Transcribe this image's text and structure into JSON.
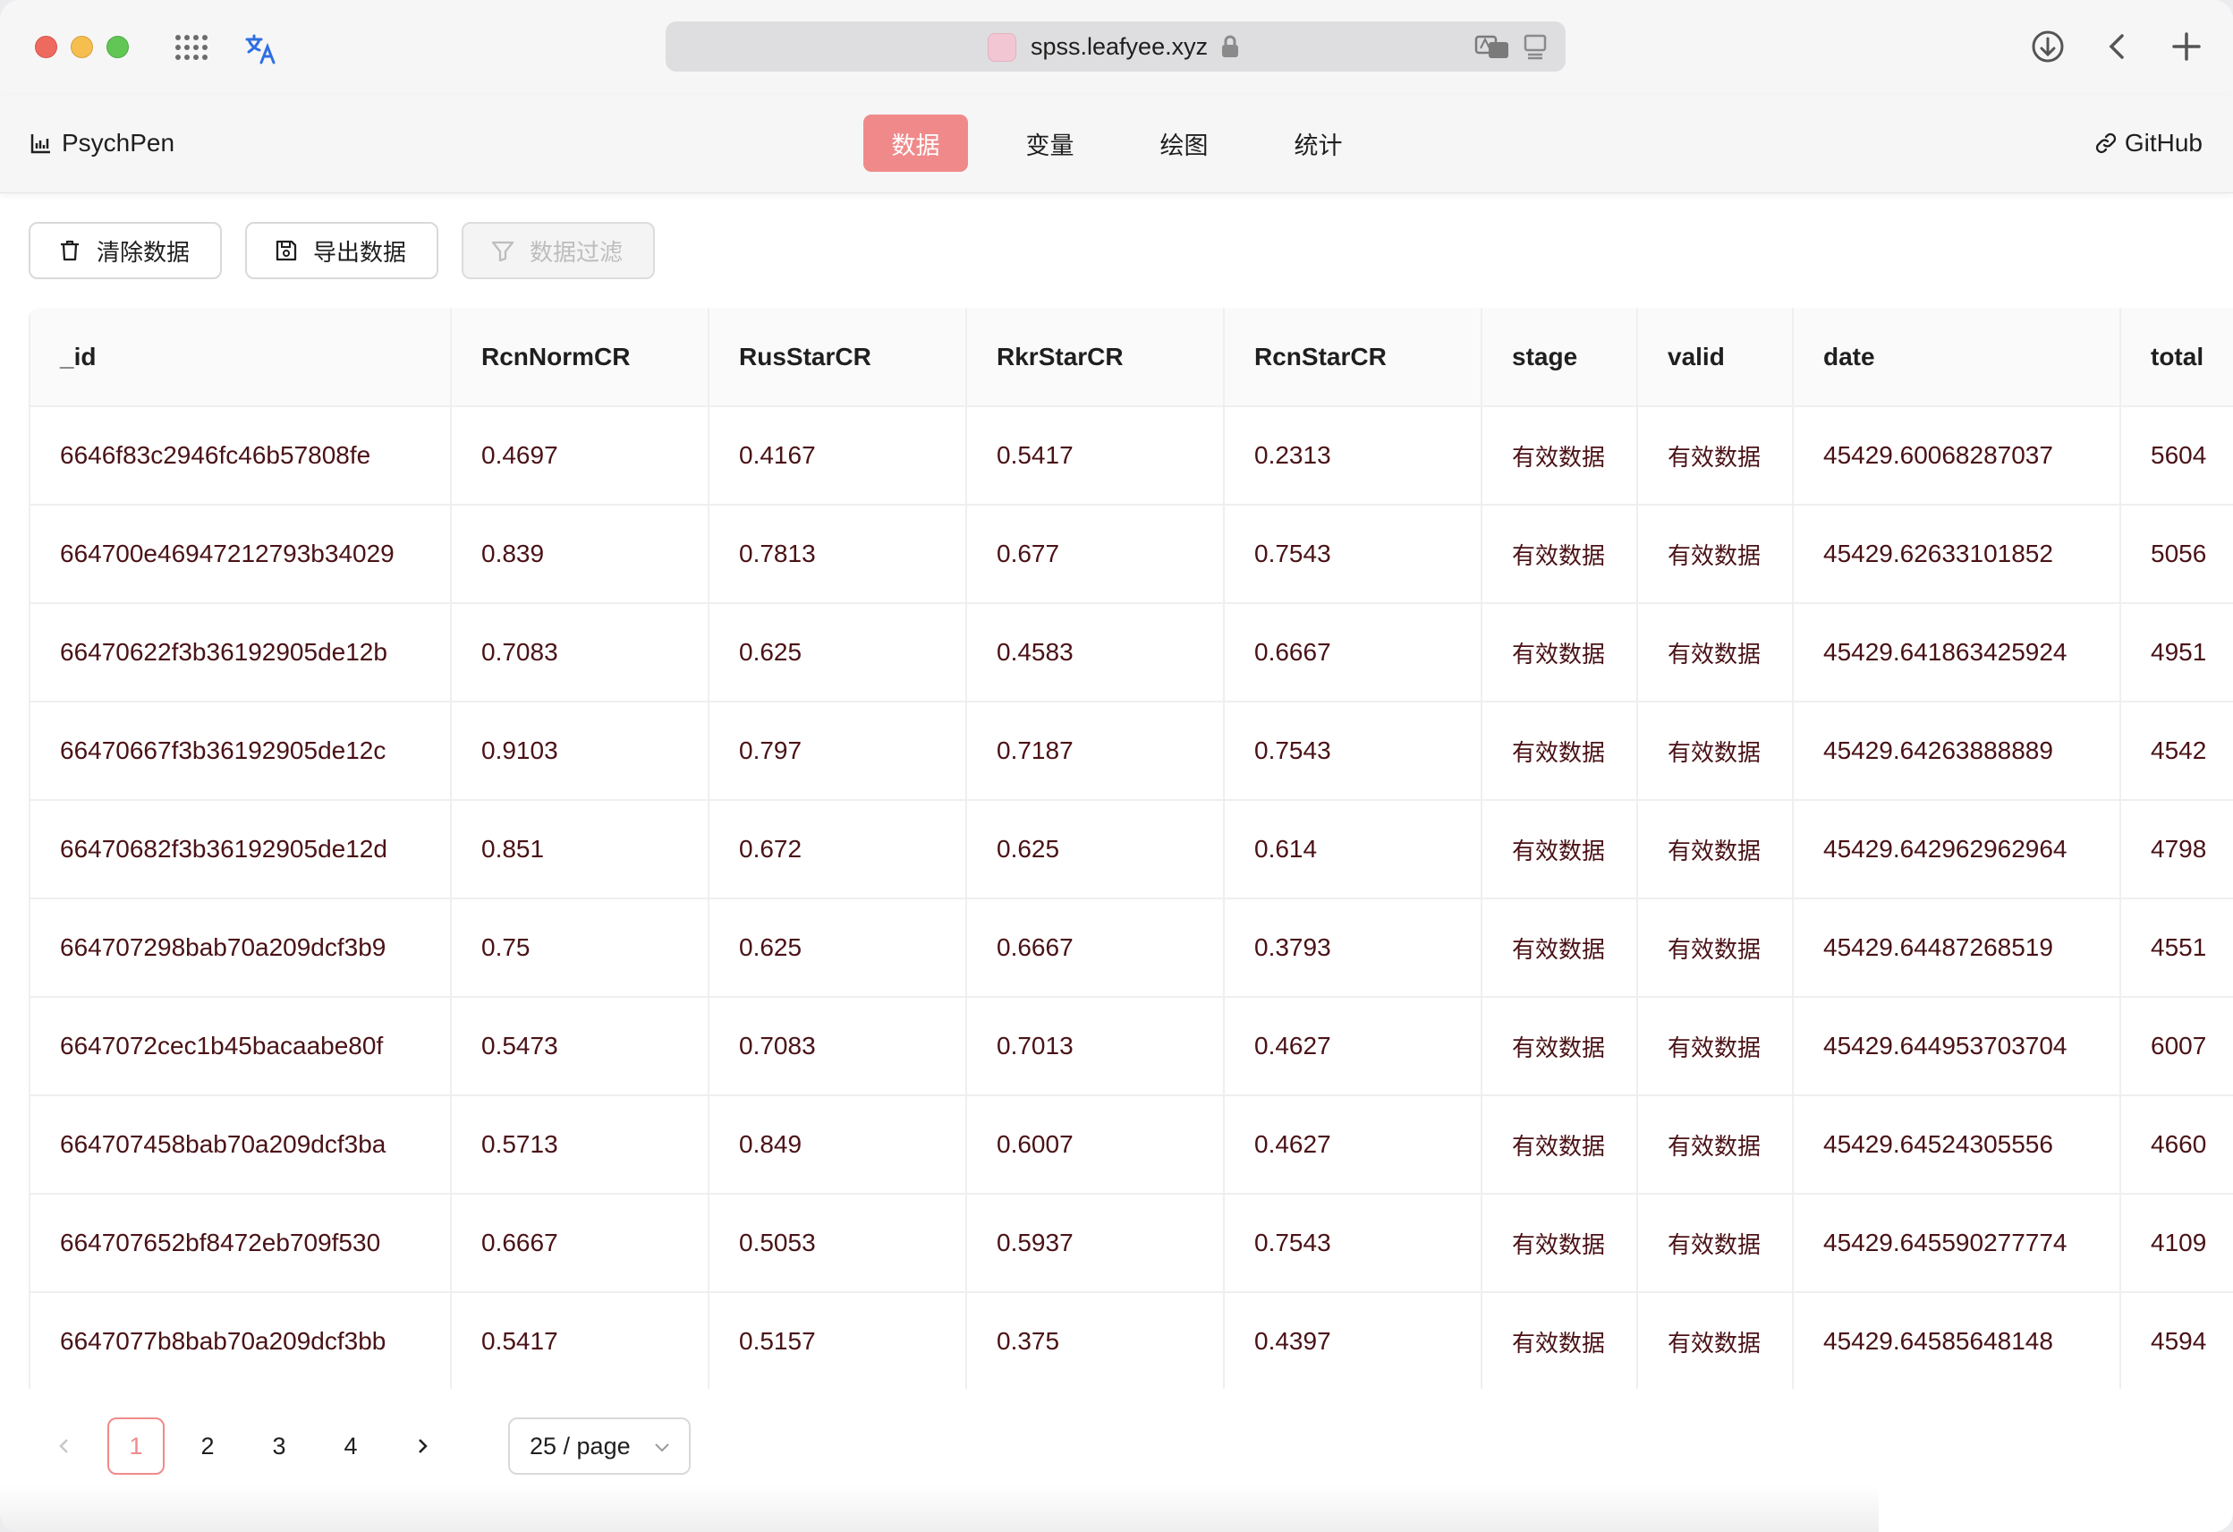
{
  "browser": {
    "url": "spss.leafyee.xyz"
  },
  "app": {
    "brand": "PsychPen",
    "github": "GitHub",
    "nav": [
      "数据",
      "变量",
      "绘图",
      "统计"
    ],
    "nav_active": "数据"
  },
  "toolbar": {
    "clear": "清除数据",
    "export": "导出数据",
    "filter": "数据过滤"
  },
  "table": {
    "columns": [
      "_id",
      "RcnNormCR",
      "RusStarCR",
      "RkrStarCR",
      "RcnStarCR",
      "stage",
      "valid",
      "date",
      "total"
    ],
    "rows": [
      [
        "6646f83c2946fc46b57808fe",
        "0.4697",
        "0.4167",
        "0.5417",
        "0.2313",
        "有效数据",
        "有效数据",
        "45429.60068287037",
        "5604"
      ],
      [
        "664700e46947212793b34029",
        "0.839",
        "0.7813",
        "0.677",
        "0.7543",
        "有效数据",
        "有效数据",
        "45429.62633101852",
        "5056"
      ],
      [
        "66470622f3b36192905de12b",
        "0.7083",
        "0.625",
        "0.4583",
        "0.6667",
        "有效数据",
        "有效数据",
        "45429.641863425924",
        "4951"
      ],
      [
        "66470667f3b36192905de12c",
        "0.9103",
        "0.797",
        "0.7187",
        "0.7543",
        "有效数据",
        "有效数据",
        "45429.64263888889",
        "4542"
      ],
      [
        "66470682f3b36192905de12d",
        "0.851",
        "0.672",
        "0.625",
        "0.614",
        "有效数据",
        "有效数据",
        "45429.642962962964",
        "4798"
      ],
      [
        "664707298bab70a209dcf3b9",
        "0.75",
        "0.625",
        "0.6667",
        "0.3793",
        "有效数据",
        "有效数据",
        "45429.64487268519",
        "4551"
      ],
      [
        "6647072cec1b45bacaabe80f",
        "0.5473",
        "0.7083",
        "0.7013",
        "0.4627",
        "有效数据",
        "有效数据",
        "45429.644953703704",
        "6007"
      ],
      [
        "664707458bab70a209dcf3ba",
        "0.5713",
        "0.849",
        "0.6007",
        "0.4627",
        "有效数据",
        "有效数据",
        "45429.64524305556",
        "4660"
      ],
      [
        "664707652bf8472eb709f530",
        "0.6667",
        "0.5053",
        "0.5937",
        "0.7543",
        "有效数据",
        "有效数据",
        "45429.645590277774",
        "4109"
      ],
      [
        "6647077b8bab70a209dcf3bb",
        "0.5417",
        "0.5157",
        "0.375",
        "0.4397",
        "有效数据",
        "有效数据",
        "45429.64585648148",
        "4594"
      ]
    ]
  },
  "pagination": {
    "pages": [
      "1",
      "2",
      "3",
      "4"
    ],
    "current": "1",
    "page_size": "25 / page"
  },
  "colors": {
    "accent": "#f08a8a",
    "cell_text": "#4a1216"
  }
}
